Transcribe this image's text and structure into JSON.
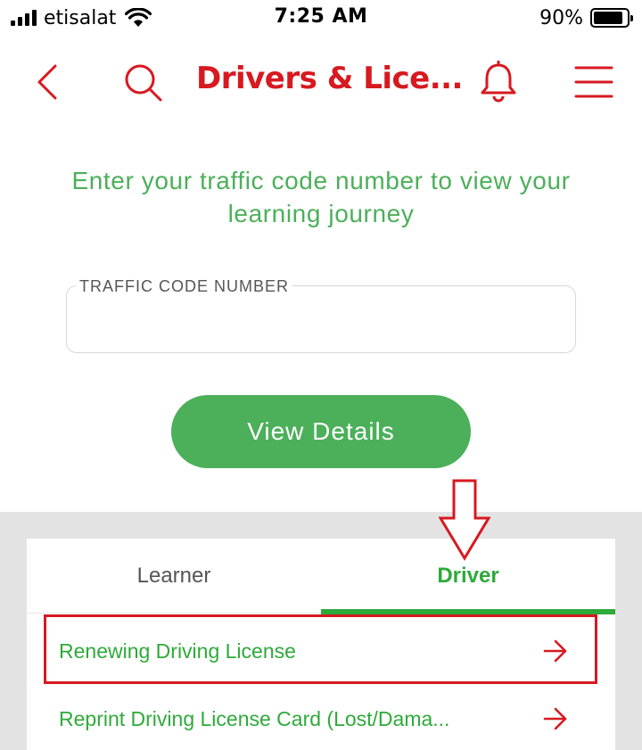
{
  "status_bar": {
    "carrier": "etisalat",
    "time": "7:25 AM",
    "battery_percent": "90%",
    "battery_level": 0.9,
    "icons": [
      "signal-icon",
      "wifi-icon",
      "battery-icon"
    ]
  },
  "header": {
    "title": "Drivers & Lice...",
    "icons": [
      "back-icon",
      "search-icon",
      "bell-icon",
      "menu-icon"
    ]
  },
  "intro": {
    "text": "Enter your traffic code number to view your learning journey"
  },
  "traffic_code": {
    "label": "TRAFFIC CODE NUMBER",
    "value": "",
    "placeholder": ""
  },
  "view_details_label": "View Details",
  "tabs": [
    {
      "label": "Learner",
      "active": false
    },
    {
      "label": "Driver",
      "active": true
    }
  ],
  "services": [
    {
      "label": "Renewing Driving License",
      "icon": "arrow-right-icon"
    },
    {
      "label": "Reprint Driving License Card (Lost/Dama...",
      "icon": "arrow-right-icon"
    }
  ],
  "colors": {
    "brand_red": "#d71920",
    "green": "#4caf5a",
    "tab_green": "#2eaa3a",
    "section_gray": "#e3e3e3"
  }
}
